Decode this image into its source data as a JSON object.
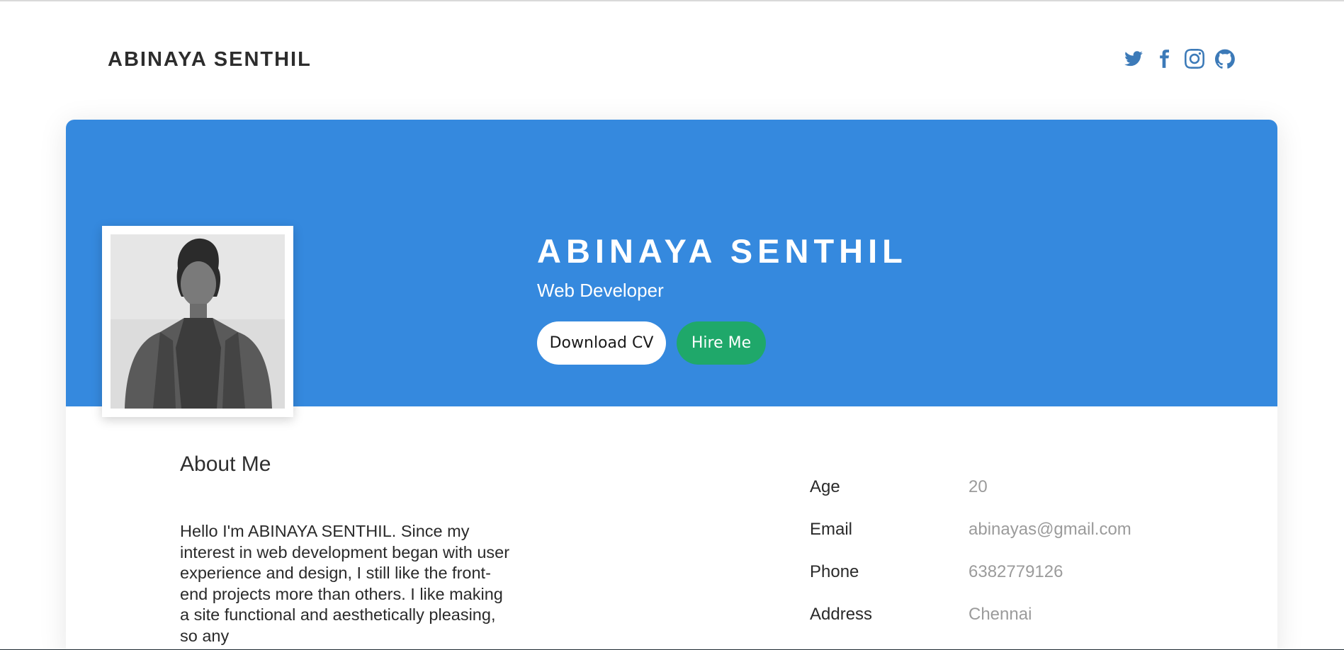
{
  "header": {
    "site_name": "ABINAYA SENTHIL",
    "social_icons": [
      "twitter-icon",
      "facebook-icon",
      "instagram-icon",
      "github-icon"
    ],
    "icon_color": "#3c7ab8"
  },
  "hero": {
    "name": "ABINAYA SENTHIL",
    "role": "Web Developer",
    "download_label": "Download CV",
    "hire_label": "Hire Me",
    "background_color": "#3589de",
    "hire_color": "#1fa86a"
  },
  "about": {
    "title": "About Me",
    "text": "Hello I'm ABINAYA SENTHIL. Since my interest in web development began with user experience and design, I still like the front-end projects more than others. I like making a site functional and aesthetically pleasing, so any"
  },
  "info": [
    {
      "label": "Age",
      "value": "20"
    },
    {
      "label": "Email",
      "value": "abinayas@gmail.com"
    },
    {
      "label": "Phone",
      "value": "6382779126"
    },
    {
      "label": "Address",
      "value": "Chennai"
    }
  ]
}
